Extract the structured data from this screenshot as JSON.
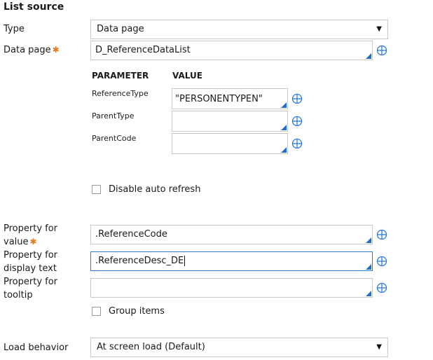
{
  "section": {
    "title": "List source"
  },
  "type": {
    "label": "Type",
    "value": "Data page"
  },
  "data_page": {
    "label": "Data page",
    "value": "D_ReferenceDataList"
  },
  "params": {
    "header_parameter": "PARAMETER",
    "header_value": "VALUE",
    "rows": [
      {
        "name": "ReferenceType",
        "value": "\"PERSONENTYPEN\""
      },
      {
        "name": "ParentType",
        "value": ""
      },
      {
        "name": "ParentCode",
        "value": ""
      }
    ]
  },
  "disable_auto_refresh": {
    "label": "Disable auto refresh",
    "checked": false
  },
  "prop_value": {
    "label_line1": "Property for",
    "label_line2": "value",
    "value": ".ReferenceCode"
  },
  "prop_display": {
    "label_line1": "Property for",
    "label_line2": "display text",
    "value": ".ReferenceDesc_DE"
  },
  "prop_tooltip": {
    "label_line1": "Property for",
    "label_line2": "tooltip",
    "value": ""
  },
  "group_items": {
    "label": "Group items",
    "checked": false
  },
  "load_behavior": {
    "label": "Load behavior",
    "value": "At screen load (Default)"
  },
  "icons": {
    "target": "crosshair-target-icon",
    "dropdown": "chevron-down-icon"
  },
  "colors": {
    "accent": "#1f6fd1",
    "required": "#e07b1a",
    "focus": "#2a7bd4"
  }
}
